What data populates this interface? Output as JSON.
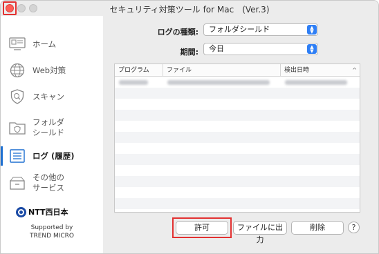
{
  "window": {
    "title": "セキュリティ対策ツール for Mac　(Ver.3)"
  },
  "sidebar": {
    "items": [
      {
        "label": "ホーム",
        "icon": "home-monitor-icon"
      },
      {
        "label": "Web対策",
        "icon": "globe-icon"
      },
      {
        "label": "スキャン",
        "icon": "shield-scan-icon"
      },
      {
        "label": "フォルダ\nシールド",
        "icon": "folder-shield-icon"
      },
      {
        "label": "ログ (履歴)",
        "icon": "log-list-icon",
        "active": true
      },
      {
        "label": "その他の\nサービス",
        "icon": "services-icon"
      }
    ],
    "logo_text": "NTT西日本",
    "supported_by": "Supported by",
    "trend_micro": "TREND MICRO"
  },
  "filters": {
    "log_type_label": "ログの種類:",
    "log_type_value": "フォルダシールド",
    "period_label": "期間:",
    "period_value": "今日"
  },
  "table": {
    "columns": [
      "プログラム",
      "ファイル",
      "検出日時"
    ],
    "sort_indicator": "^"
  },
  "buttons": {
    "allow": "許可",
    "export": "ファイルに出力",
    "delete": "削除",
    "help": "?"
  },
  "colors": {
    "accent": "#2f7ff5",
    "highlight": "#e33131",
    "active_bar": "#1d6fd1"
  }
}
